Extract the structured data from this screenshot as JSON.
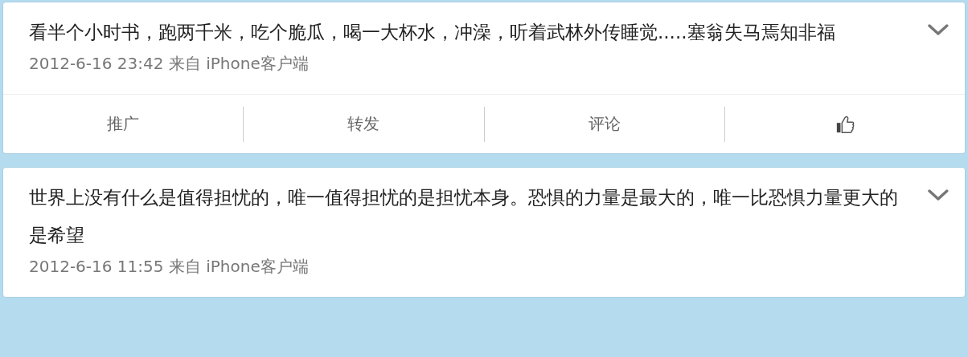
{
  "posts": [
    {
      "text": "看半个小时书，跑两千米，吃个脆瓜，喝一大杯水，冲澡，听着武林外传睡觉.....塞翁失马焉知非福",
      "meta": "2012-6-16 23:42 来自 iPhone客户端",
      "actions": [
        {
          "kind": "text",
          "label": "推广"
        },
        {
          "kind": "text",
          "label": "转发"
        },
        {
          "kind": "text",
          "label": "评论"
        },
        {
          "kind": "like"
        }
      ]
    },
    {
      "text": "世界上没有什么是值得担忧的，唯一值得担忧的是担忧本身。恐惧的力量是最大的，唯一比恐惧力量更大的是希望",
      "meta": "2012-6-16 11:55 来自 iPhone客户端"
    }
  ]
}
